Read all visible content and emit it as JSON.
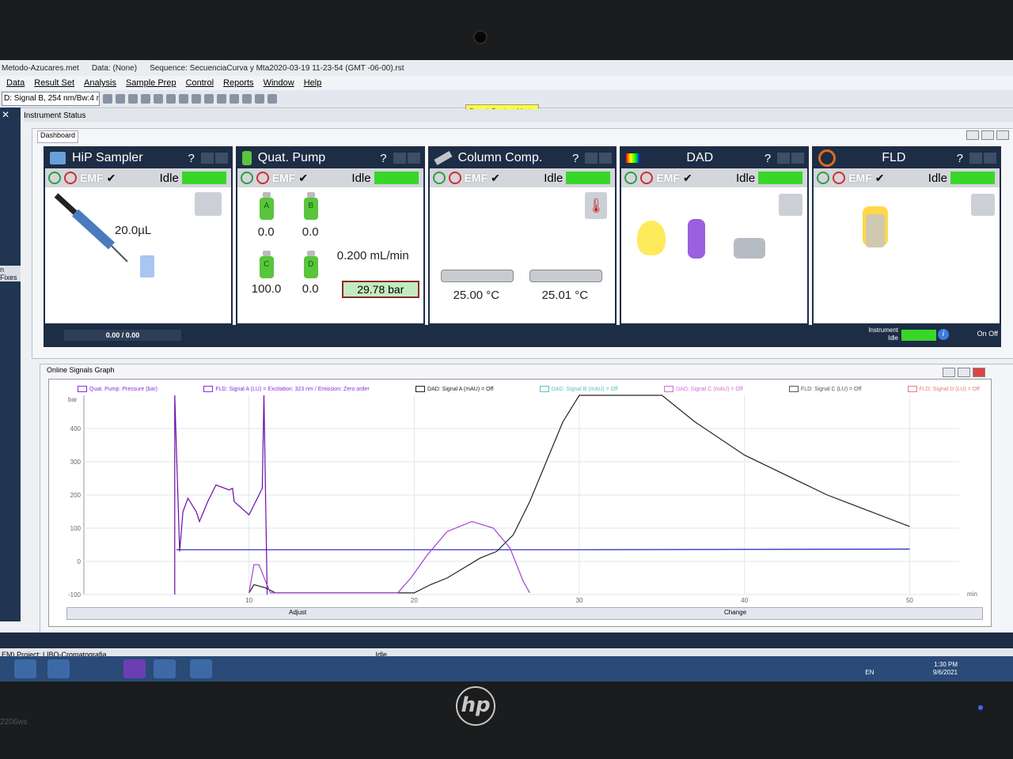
{
  "window": {
    "method": "Metodo-Azucares.met",
    "data": "Data: (None)",
    "sequence": "Sequence: SecuenciaCurva y Mta2020-03-19 11-23-54 (GMT -06-00).rst"
  },
  "menu": [
    "Data",
    "Result Set",
    "Analysis",
    "Sample Prep",
    "Control",
    "Reports",
    "Window",
    "Help"
  ],
  "toolbar": {
    "signal_select": "D: Signal B, 254 nm/Bw:4 nm",
    "result_review_mode": "Result Review Mode"
  },
  "left_panel": {
    "label": "n Fixes"
  },
  "instrument_status": {
    "title": "Instrument Status",
    "dashboard_tab": "Dashboard",
    "modules": {
      "sampler": {
        "title": "HiP Sampler",
        "emf": "EMF",
        "state": "Idle",
        "volume": "20.0µL"
      },
      "pump": {
        "title": "Quat. Pump",
        "emf": "EMF",
        "state": "Idle",
        "bottles": [
          {
            "label": "A",
            "value": "0.0"
          },
          {
            "label": "B",
            "value": "0.0"
          },
          {
            "label": "C",
            "value": "100.0"
          },
          {
            "label": "D",
            "value": "0.0"
          }
        ],
        "flow": "0.200 mL/min",
        "pressure": "29.78 bar"
      },
      "column": {
        "title": "Column Comp.",
        "emf": "EMF",
        "state": "Idle",
        "temp_left": "25.00 °C",
        "temp_right": "25.01 °C"
      },
      "dad": {
        "title": "DAD",
        "emf": "EMF",
        "state": "Idle"
      },
      "fld": {
        "title": "FLD",
        "emf": "EMF",
        "state": "Idle"
      }
    },
    "progress": "0.00 / 0.00",
    "instrument_label": "Instrument",
    "instrument_state": "Idle",
    "on_label": "On",
    "off_label": "Off"
  },
  "online_signals": {
    "title": "Online Signals Graph",
    "legend": [
      {
        "label": "Quat. Pump: Pressure (bar)",
        "color": "#8a2be2"
      },
      {
        "label": "FLD: Signal A (LU) = Excitation: 323 nm / Emission: Zero order",
        "color": "#8a2be2"
      },
      {
        "label": "DAD: Signal A (mAU) = Off",
        "color": "#222222"
      },
      {
        "label": "DAD: Signal B (mAU) = Off",
        "color": "#5bbfbf"
      },
      {
        "label": "DAD: Signal C (mAU) = Off",
        "color": "#d36ad3"
      },
      {
        "label": "FLD: Signal C (LU) = Off",
        "color": "#555555"
      },
      {
        "label": "FLD: Signal D (LU) = Off",
        "color": "#e08080"
      }
    ],
    "adjust_label": "Adjust",
    "change_label": "Change"
  },
  "chart_data": {
    "type": "line",
    "xlabel": "min",
    "ylabel": "bar",
    "xlim": [
      0,
      53
    ],
    "ylim": [
      -100,
      500
    ],
    "x_ticks": [
      10,
      20,
      30,
      40,
      50
    ],
    "y_ticks": [
      -100,
      0,
      100,
      200,
      300,
      400
    ],
    "series": [
      {
        "name": "Quat. Pump: Pressure (bar)",
        "color": "#6a0dad",
        "points": [
          [
            5.5,
            -100
          ],
          [
            5.5,
            500
          ],
          [
            5.8,
            30
          ],
          [
            6.0,
            150
          ],
          [
            6.3,
            190
          ],
          [
            6.8,
            150
          ],
          [
            7.0,
            120
          ],
          [
            7.5,
            180
          ],
          [
            8.0,
            230
          ],
          [
            8.8,
            215
          ],
          [
            9.0,
            220
          ],
          [
            9.1,
            180
          ],
          [
            10.0,
            140
          ],
          [
            10.8,
            220
          ],
          [
            10.9,
            500
          ],
          [
            11.1,
            -100
          ]
        ]
      },
      {
        "name": "FLD: Signal A (LU) = Excitation: 323 nm / Emission: Zero order",
        "color": "#2222cc",
        "points": [
          [
            5.6,
            35
          ],
          [
            30,
            35
          ],
          [
            50,
            37
          ]
        ]
      },
      {
        "name": "DAD: Signal A (mAU) = Off",
        "color": "#222222",
        "points": [
          [
            10,
            -95
          ],
          [
            10.3,
            -70
          ],
          [
            11.0,
            -80
          ],
          [
            11.6,
            -95
          ],
          [
            20,
            -95
          ],
          [
            21,
            -70
          ],
          [
            22,
            -50
          ],
          [
            23,
            -20
          ],
          [
            24,
            10
          ],
          [
            25,
            30
          ],
          [
            26,
            80
          ],
          [
            27,
            180
          ],
          [
            28,
            300
          ],
          [
            29,
            420
          ],
          [
            30,
            500
          ],
          [
            35,
            500
          ],
          [
            37,
            420
          ],
          [
            40,
            320
          ],
          [
            45,
            200
          ],
          [
            50,
            105
          ]
        ]
      },
      {
        "name": "DAD: Signal C (mAU) = Off",
        "color": "#a040d8",
        "points": [
          [
            10,
            -95
          ],
          [
            10.3,
            -10
          ],
          [
            10.6,
            -10
          ],
          [
            11.0,
            -60
          ],
          [
            11.3,
            -95
          ],
          [
            19,
            -95
          ],
          [
            19.8,
            -50
          ],
          [
            20.8,
            20
          ],
          [
            22,
            90
          ],
          [
            23.5,
            120
          ],
          [
            24.8,
            100
          ],
          [
            25.8,
            40
          ],
          [
            26.6,
            -60
          ],
          [
            27,
            -95
          ]
        ]
      }
    ]
  },
  "status_bar": {
    "project": "EM) Project: LIBQ-Cromatografia",
    "state": "Idle"
  },
  "taskbar": {
    "lang": "EN",
    "time": "1:30 PM",
    "date": "9/6/2021"
  },
  "monitor": {
    "brand": "hp",
    "model": "2206ws"
  }
}
